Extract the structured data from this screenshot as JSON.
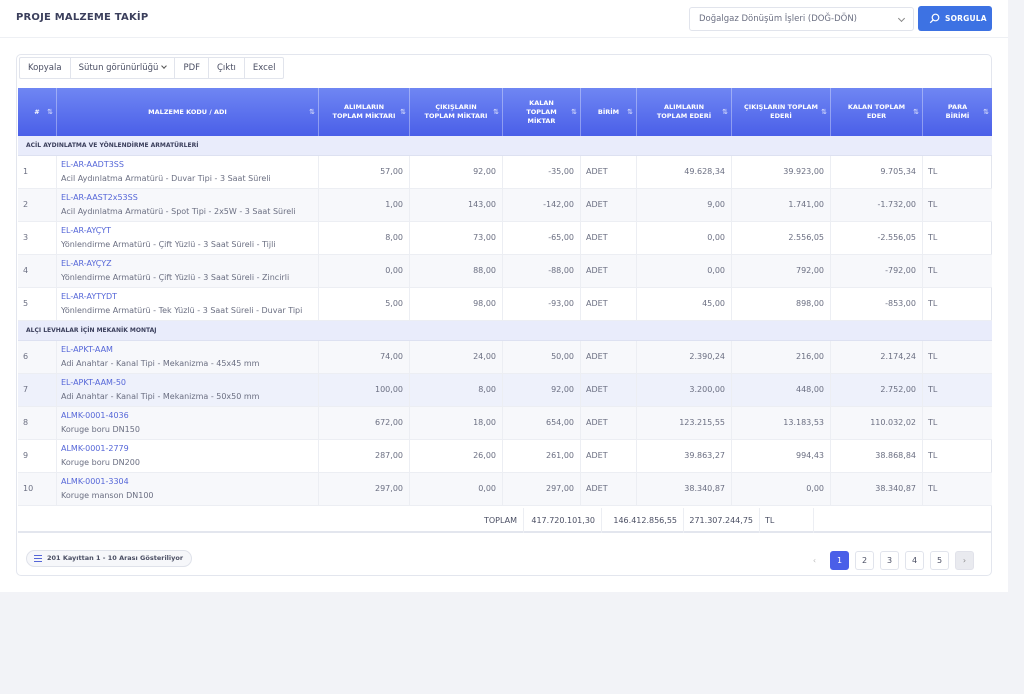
{
  "header": {
    "title": "PROJE MALZEME TAKİP",
    "project_select": "Doğalgaz Dönüşüm İşleri (DOĞ-DÖN)",
    "query_button": "SORGULA"
  },
  "toolbar": [
    "Kopyala",
    "Sütun görünürlüğü",
    "PDF",
    "Çıktı",
    "Excel"
  ],
  "columns": [
    "#",
    "MALZEME KODU / ADI",
    "ALIMLARIN TOPLAM MİKTARI",
    "ÇIKIŞLARIN TOPLAM MİKTARI",
    "KALAN TOPLAM MİKTAR",
    "BİRİM",
    "ALIMLARIN TOPLAM EDERİ",
    "ÇIKIŞLARIN TOPLAM EDERİ",
    "KALAN TOPLAM EDER",
    "PARA BİRİMİ"
  ],
  "groups": [
    {
      "title": "ACİL AYDINLATMA VE YÖNLENDİRME ARMATÜRLERİ",
      "rows": [
        {
          "no": "1",
          "code": "EL-AR-AADT3SS",
          "name": "Acil Aydınlatma Armatürü - Duvar Tipi - 3 Saat Süreli",
          "in_qty": "57,00",
          "out_qty": "92,00",
          "rem_qty": "-35,00",
          "unit": "ADET",
          "in_val": "49.628,34",
          "out_val": "39.923,00",
          "rem_val": "9.705,34",
          "cur": "TL"
        },
        {
          "no": "2",
          "code": "EL-AR-AAST2x53SS",
          "name": "Acil Aydınlatma Armatürü - Spot Tipi - 2x5W - 3 Saat Süreli",
          "in_qty": "1,00",
          "out_qty": "143,00",
          "rem_qty": "-142,00",
          "unit": "ADET",
          "in_val": "9,00",
          "out_val": "1.741,00",
          "rem_val": "-1.732,00",
          "cur": "TL"
        },
        {
          "no": "3",
          "code": "EL-AR-AYÇYT",
          "name": "Yönlendirme Armatürü - Çift Yüzlü - 3 Saat Süreli - Tijli",
          "in_qty": "8,00",
          "out_qty": "73,00",
          "rem_qty": "-65,00",
          "unit": "ADET",
          "in_val": "0,00",
          "out_val": "2.556,05",
          "rem_val": "-2.556,05",
          "cur": "TL"
        },
        {
          "no": "4",
          "code": "EL-AR-AYÇYZ",
          "name": "Yönlendirme Armatürü - Çift Yüzlü - 3 Saat Süreli - Zincirli",
          "in_qty": "0,00",
          "out_qty": "88,00",
          "rem_qty": "-88,00",
          "unit": "ADET",
          "in_val": "0,00",
          "out_val": "792,00",
          "rem_val": "-792,00",
          "cur": "TL"
        },
        {
          "no": "5",
          "code": "EL-AR-AYTYDT",
          "name": "Yönlendirme Armatürü - Tek Yüzlü - 3 Saat Süreli - Duvar Tipi",
          "in_qty": "5,00",
          "out_qty": "98,00",
          "rem_qty": "-93,00",
          "unit": "ADET",
          "in_val": "45,00",
          "out_val": "898,00",
          "rem_val": "-853,00",
          "cur": "TL"
        }
      ]
    },
    {
      "title": "ALÇI LEVHALAR İÇİN MEKANİK MONTAJ",
      "rows": [
        {
          "no": "6",
          "code": "EL-APKT-AAM",
          "name": "Adi Anahtar - Kanal Tipi - Mekanizma - 45x45 mm",
          "in_qty": "74,00",
          "out_qty": "24,00",
          "rem_qty": "50,00",
          "unit": "ADET",
          "in_val": "2.390,24",
          "out_val": "216,00",
          "rem_val": "2.174,24",
          "cur": "TL"
        },
        {
          "no": "7",
          "code": "EL-APKT-AAM-50",
          "name": "Adi Anahtar - Kanal Tipi - Mekanizma - 50x50 mm",
          "in_qty": "100,00",
          "out_qty": "8,00",
          "rem_qty": "92,00",
          "unit": "ADET",
          "in_val": "3.200,00",
          "out_val": "448,00",
          "rem_val": "2.752,00",
          "cur": "TL"
        },
        {
          "no": "8",
          "code": "ALMK-0001-4036",
          "name": "Koruge boru DN150",
          "in_qty": "672,00",
          "out_qty": "18,00",
          "rem_qty": "654,00",
          "unit": "ADET",
          "in_val": "123.215,55",
          "out_val": "13.183,53",
          "rem_val": "110.032,02",
          "cur": "TL"
        },
        {
          "no": "9",
          "code": "ALMK-0001-2779",
          "name": "Koruge boru DN200",
          "in_qty": "287,00",
          "out_qty": "26,00",
          "rem_qty": "261,00",
          "unit": "ADET",
          "in_val": "39.863,27",
          "out_val": "994,43",
          "rem_val": "38.868,84",
          "cur": "TL"
        },
        {
          "no": "10",
          "code": "ALMK-0001-3304",
          "name": "Koruge manson DN100",
          "in_qty": "297,00",
          "out_qty": "0,00",
          "rem_qty": "297,00",
          "unit": "ADET",
          "in_val": "38.340,87",
          "out_val": "0,00",
          "rem_val": "38.340,87",
          "cur": "TL"
        }
      ]
    }
  ],
  "totals": {
    "label": "TOPLAM",
    "in_val": "417.720.101,30",
    "out_val": "146.412.856,55",
    "rem_val": "271.307.244,75",
    "cur": "TL"
  },
  "footer": {
    "info": "201 Kayıttan 1 - 10 Arası Gösteriliyor",
    "pages": [
      "1",
      "2",
      "3",
      "4",
      "5"
    ],
    "prev": "‹",
    "next": "›"
  },
  "colors": {
    "accent": "#4a5fe8",
    "button": "#3d72e3",
    "group_bg": "#e9ecfb",
    "link": "#5566d8"
  }
}
